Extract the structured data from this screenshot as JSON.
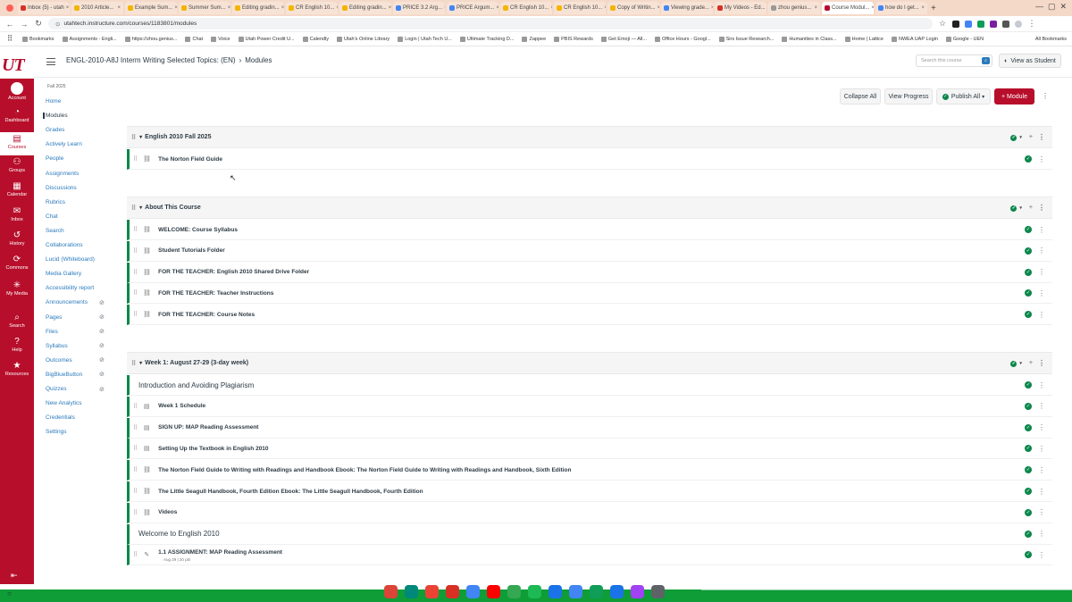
{
  "browser": {
    "tabs": [
      {
        "label": "Inbox (5) - utah",
        "color": "#d93025"
      },
      {
        "label": "2010 Article...",
        "color": "#f4b400"
      },
      {
        "label": "Example Sum...",
        "color": "#f4b400"
      },
      {
        "label": "Summer Sum...",
        "color": "#f4b400"
      },
      {
        "label": "Editing gradin...",
        "color": "#f4b400"
      },
      {
        "label": "CR English 10...",
        "color": "#f4b400"
      },
      {
        "label": "Editing gradin...",
        "color": "#f4b400"
      },
      {
        "label": "PRICE 3.2 Arg...",
        "color": "#4285f4"
      },
      {
        "label": "PRICE Argum...",
        "color": "#4285f4"
      },
      {
        "label": "CR English 10...",
        "color": "#f4b400"
      },
      {
        "label": "CR English 10...",
        "color": "#f4b400"
      },
      {
        "label": "Copy of Writin...",
        "color": "#f4b400"
      },
      {
        "label": "Viewing grade...",
        "color": "#4285f4"
      },
      {
        "label": "My Videos - Ed...",
        "color": "#d93025"
      },
      {
        "label": "zhou genius...",
        "color": "#999999"
      },
      {
        "label": "Course Modul...",
        "color": "#b70f2b"
      },
      {
        "label": "how do I get...",
        "color": "#4285f4"
      }
    ],
    "active_tab_index": 15,
    "url": "utahtech.instructure.com/courses/1183801/modules",
    "bookmarks": [
      "Bookmarks",
      "Assignments - Engli...",
      "https://zhou.genius...",
      "Chat",
      "Voice",
      "Utah Power Credit U...",
      "Calendly",
      "Utah's Online Library",
      "Login | Utah Tech U...",
      "Ultimate Tracking D...",
      "Zappee",
      "PBIS Rewards",
      "Get Emoji — All...",
      "Office Hours - Googl...",
      "Sirs Issue Research...",
      "Humanities in Class...",
      "Home | Lattice",
      "NWEA UAP Login",
      "Google - UEN"
    ],
    "all_bookmarks": "All Bookmarks"
  },
  "canvas": {
    "brand_color": "#b70f2b",
    "logo_text": "UT",
    "global_nav": [
      {
        "label": "Account",
        "icon": "account-icon"
      },
      {
        "label": "Dashboard",
        "icon": "dashboard-icon"
      },
      {
        "label": "Courses",
        "icon": "courses-icon"
      },
      {
        "label": "Groups",
        "icon": "groups-icon"
      },
      {
        "label": "Calendar",
        "icon": "calendar-icon"
      },
      {
        "label": "Inbox",
        "icon": "inbox-icon"
      },
      {
        "label": "History",
        "icon": "history-icon"
      },
      {
        "label": "Commons",
        "icon": "commons-icon"
      },
      {
        "label": "My Media",
        "icon": "my-media-icon"
      },
      {
        "label": "Search",
        "icon": "search-icon"
      },
      {
        "label": "Help",
        "icon": "help-icon"
      },
      {
        "label": "Resources",
        "icon": "resources-icon"
      }
    ],
    "breadcrumb": {
      "course": "ENGL-2010-A8J Interm Writing Selected Topics: (EN)",
      "separator": "›",
      "page": "Modules"
    },
    "search_placeholder": "Search this course",
    "view_as_student": "View as Student",
    "term": "Fall 2025",
    "course_nav": [
      {
        "label": "Home",
        "hidden": false
      },
      {
        "label": "Modules",
        "hidden": false,
        "active": true
      },
      {
        "label": "Grades",
        "hidden": false
      },
      {
        "label": "Actively Learn",
        "hidden": false
      },
      {
        "label": "People",
        "hidden": false
      },
      {
        "label": "Assignments",
        "hidden": false
      },
      {
        "label": "Discussions",
        "hidden": false
      },
      {
        "label": "Rubrics",
        "hidden": false
      },
      {
        "label": "Chat",
        "hidden": false
      },
      {
        "label": "Search",
        "hidden": false
      },
      {
        "label": "Collaborations",
        "hidden": false
      },
      {
        "label": "Lucid (Whiteboard)",
        "hidden": false
      },
      {
        "label": "Media Gallery",
        "hidden": false
      },
      {
        "label": "Accessibility report",
        "hidden": false
      },
      {
        "label": "Announcements",
        "hidden": true
      },
      {
        "label": "Pages",
        "hidden": true
      },
      {
        "label": "Files",
        "hidden": true
      },
      {
        "label": "Syllabus",
        "hidden": true
      },
      {
        "label": "Outcomes",
        "hidden": true
      },
      {
        "label": "BigBlueButton",
        "hidden": true
      },
      {
        "label": "Quizzes",
        "hidden": true
      },
      {
        "label": "New Analytics",
        "hidden": false
      },
      {
        "label": "Credentials",
        "hidden": false
      },
      {
        "label": "Settings",
        "hidden": false
      }
    ],
    "toolbar": {
      "collapse_all": "Collapse All",
      "view_progress": "View Progress",
      "publish_all": "Publish All",
      "add_module": "+ Module"
    },
    "modules": [
      {
        "title": "English 2010 Fall 2025",
        "items": [
          {
            "type": "link",
            "title": "The Norton Field Guide"
          }
        ]
      },
      {
        "title": "About This Course",
        "items": [
          {
            "type": "link",
            "title": "WELCOME: Course Syllabus"
          },
          {
            "type": "link",
            "title": "Student Tutorials Folder"
          },
          {
            "type": "link",
            "title": "FOR THE TEACHER: English 2010 Shared Drive Folder"
          },
          {
            "type": "link",
            "title": "FOR THE TEACHER: Teacher Instructions"
          },
          {
            "type": "link",
            "title": "FOR THE TEACHER: Course Notes"
          }
        ]
      },
      {
        "title": "Week 1: August 27-29 (3-day week)",
        "items": [
          {
            "type": "subheader",
            "title": "Introduction and Avoiding Plagiarism"
          },
          {
            "type": "page",
            "title": "Week 1 Schedule"
          },
          {
            "type": "page",
            "title": "SIGN UP: MAP Reading Assessment"
          },
          {
            "type": "page",
            "title": "Setting Up the Textbook in English 2010"
          },
          {
            "type": "link",
            "title": "The Norton Field Guide to Writing with Readings and Handbook Ebook: The Norton Field Guide to Writing with Readings and Handbook, Sixth Edition"
          },
          {
            "type": "link",
            "title": "The Little Seagull Handbook, Fourth Edition Ebook: The Little Seagull Handbook, Fourth Edition"
          },
          {
            "type": "link",
            "title": "Videos"
          },
          {
            "type": "subheader",
            "title": "Welcome to English 2010"
          },
          {
            "type": "assignment",
            "title": "1.1 ASSIGNMENT: MAP Reading Assessment",
            "meta": "Aug 29 | 20 pts"
          }
        ]
      }
    ]
  },
  "dock": {
    "icons": [
      {
        "name": "chrome-icon",
        "color": "#db4437"
      },
      {
        "name": "meet-icon",
        "color": "#00897b"
      },
      {
        "name": "browser-icon",
        "color": "#ea4335"
      },
      {
        "name": "gmail-icon",
        "color": "#d93025"
      },
      {
        "name": "docs-icon",
        "color": "#4285f4"
      },
      {
        "name": "youtube-icon",
        "color": "#ff0000"
      },
      {
        "name": "play-store-icon",
        "color": "#34a853"
      },
      {
        "name": "spotify-icon",
        "color": "#1db954"
      },
      {
        "name": "files-icon",
        "color": "#1a73e8"
      },
      {
        "name": "calendar-app-icon",
        "color": "#4285f4"
      },
      {
        "name": "sheets-icon",
        "color": "#0f9d58"
      },
      {
        "name": "screencast-icon",
        "color": "#1a73e8"
      },
      {
        "name": "app-icon",
        "color": "#a142f4"
      },
      {
        "name": "settings-icon",
        "color": "#5f6368"
      }
    ]
  }
}
